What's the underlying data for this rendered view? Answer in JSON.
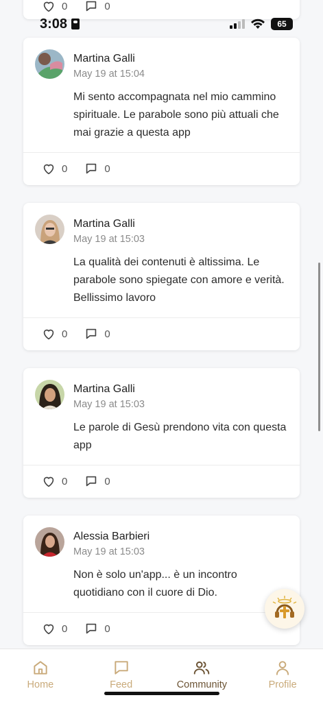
{
  "status_bar": {
    "time": "3:08",
    "battery": "65"
  },
  "top_partial_post": {
    "likes": "0",
    "comments": "0"
  },
  "posts": [
    {
      "author": "Martina Galli",
      "date": "May 19 at 15:04",
      "text": "Mi sento accompagnata nel mio cammino spirituale. Le parabole sono più attuali che mai grazie a questa app",
      "likes": "0",
      "comments": "0"
    },
    {
      "author": "Martina Galli",
      "date": "May 19 at 15:03",
      "text": "La qualità dei contenuti è altissima. Le parabole sono spiegate con amore e verità. Bellissimo lavoro",
      "likes": "0",
      "comments": "0"
    },
    {
      "author": "Martina Galli",
      "date": "May 19 at 15:03",
      "text": "Le parole di Gesù prendono vita con questa app",
      "likes": "0",
      "comments": "0"
    },
    {
      "author": "Alessia Barbieri",
      "date": "May 19 at 15:03",
      "text": "Non è solo un'app... è un incontro quotidiano con il cuore di Dio.",
      "likes": "0",
      "comments": "0"
    }
  ],
  "tabbar": {
    "items": [
      {
        "label": "Home",
        "icon": "home-icon"
      },
      {
        "label": "Feed",
        "icon": "chat-icon"
      },
      {
        "label": "Community",
        "icon": "users-icon"
      },
      {
        "label": "Profile",
        "icon": "user-icon"
      }
    ],
    "active": "Community"
  },
  "colors": {
    "accent_inactive": "#c9aa7a",
    "accent_active": "#6b5334",
    "background": "#f6f7f9"
  }
}
